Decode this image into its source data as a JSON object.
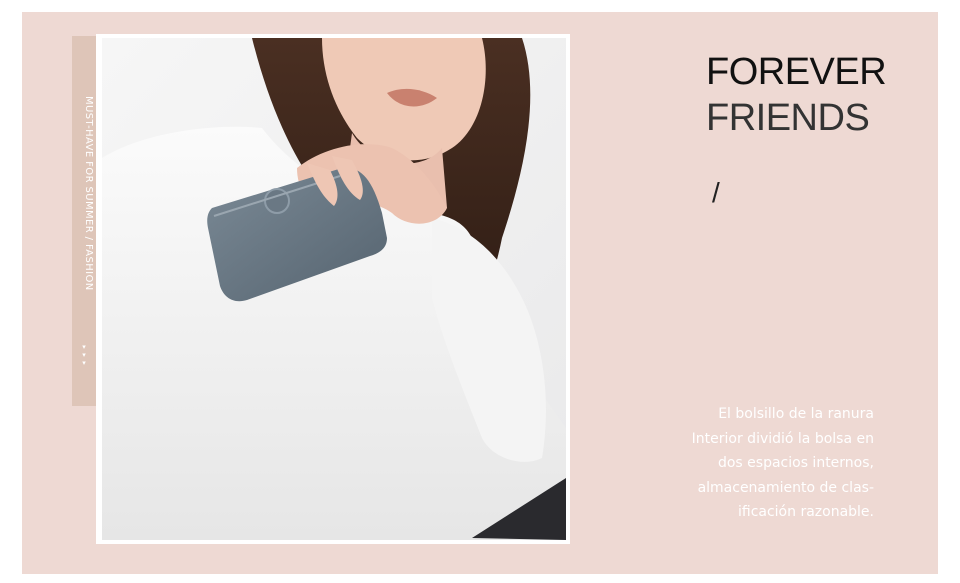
{
  "side_tab": {
    "vertical_text": "MUST-HAVE FOR SUMMER / FASHION",
    "arrow_glyphs": "▾\n▾\n▾"
  },
  "headline": {
    "line1": "FOREVER",
    "line2": "FRIENDS",
    "slash": "/"
  },
  "description": {
    "lines": [
      "El bolsillo de la ranura",
      "Interior dividió la bolsa en",
      "dos espacios internos,",
      "almacenamiento de clas-",
      "ificación razonable."
    ]
  },
  "colors": {
    "panel_background": "#eed9d3",
    "side_tab": "#dec5b8",
    "wallet": "#6b7b88",
    "text_dark": "#111111"
  },
  "photo": {
    "subject": "woman in white blouse holding a grey wallet"
  }
}
